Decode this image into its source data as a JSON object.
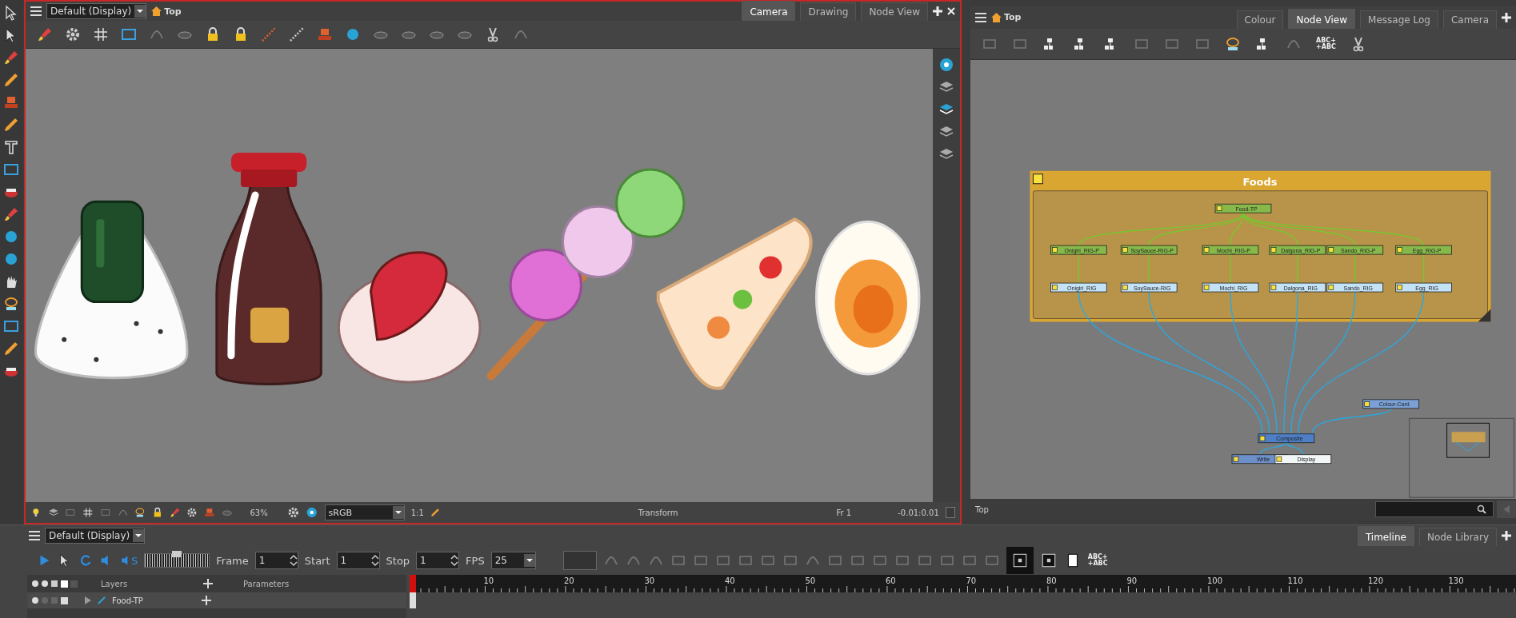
{
  "camera_view": {
    "menu_title": "Default (Display)",
    "breadcrumb": "Top",
    "tabs": [
      {
        "label": "Camera",
        "selected": true
      },
      {
        "label": "Drawing",
        "selected": false
      },
      {
        "label": "Node View",
        "selected": false
      }
    ],
    "status_bar": {
      "zoom": "63%",
      "color_space": "sRGB",
      "ratio": "1:1",
      "mode": "Transform",
      "frame": "Fr 1",
      "coordinates": "-0.01:0.01"
    }
  },
  "node_view": {
    "breadcrumb": "Top",
    "tabs": [
      {
        "label": "Colour",
        "selected": false
      },
      {
        "label": "Node View",
        "selected": true
      },
      {
        "label": "Message Log",
        "selected": false
      },
      {
        "label": "Camera",
        "selected": false
      }
    ],
    "toolbar_text": [
      "ABC+",
      "+ABC"
    ],
    "group": {
      "title": "Foods"
    },
    "nodes": [
      {
        "label": "Food-TP",
        "kind": "peg"
      },
      {
        "label": "Onigiri_RIG-P",
        "kind": "peg"
      },
      {
        "label": "SoySauce-RIG-P",
        "kind": "peg"
      },
      {
        "label": "Mochi_RIG-P",
        "kind": "peg"
      },
      {
        "label": "Dalgona_RIG-P",
        "kind": "peg"
      },
      {
        "label": "Sando_RIG-P",
        "kind": "peg"
      },
      {
        "label": "Egg_RIG-P",
        "kind": "peg"
      },
      {
        "label": "Onigiri_RIG",
        "kind": "group"
      },
      {
        "label": "SoySauce-RIG",
        "kind": "group"
      },
      {
        "label": "Mochi_RIG",
        "kind": "group"
      },
      {
        "label": "Dalgona_RIG",
        "kind": "group"
      },
      {
        "label": "Sando_RIG",
        "kind": "group"
      },
      {
        "label": "Egg_RIG",
        "kind": "group"
      },
      {
        "label": "Colour-Card",
        "kind": "card"
      },
      {
        "label": "Composite",
        "kind": "composite"
      },
      {
        "label": "Write",
        "kind": "write"
      },
      {
        "label": "Display",
        "kind": "display"
      }
    ],
    "status_bar": {
      "path": "Top"
    }
  },
  "timeline": {
    "menu_title": "Default (Display)",
    "tabs": [
      {
        "label": "Timeline",
        "selected": true
      },
      {
        "label": "Node Library",
        "selected": false
      }
    ],
    "sound_label": "S",
    "speed_slider": {
      "level": 0.5
    },
    "frame": {
      "label": "Frame",
      "value": "1"
    },
    "start": {
      "label": "Start",
      "value": "1"
    },
    "stop": {
      "label": "Stop",
      "value": "1"
    },
    "fps": {
      "label": "FPS",
      "value": "25"
    },
    "toolbar_text": [
      "ABC+",
      "+ABC"
    ],
    "layers_header": "Layers",
    "parameters_header": "Parameters",
    "layers": [
      {
        "name": "Food-TP"
      }
    ],
    "ruler_labels": [
      "10",
      "20",
      "30",
      "40",
      "50",
      "60",
      "70",
      "80",
      "90",
      "100",
      "110",
      "120",
      "130"
    ]
  }
}
